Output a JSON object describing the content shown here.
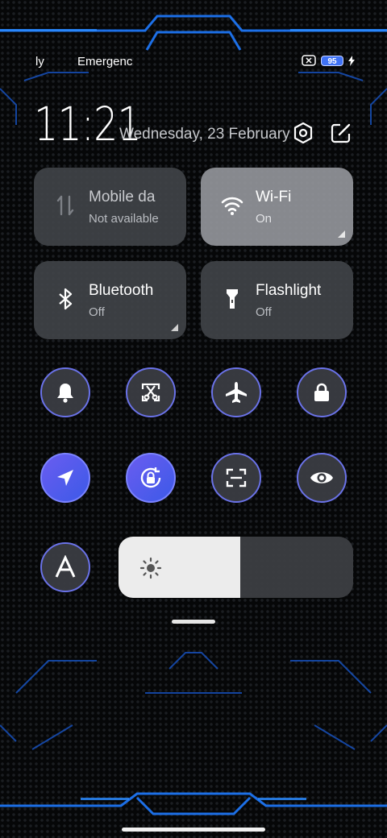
{
  "status_bar": {
    "carrier1": "ly",
    "carrier2": "Emergenc",
    "battery_level": "95"
  },
  "header": {
    "time": "11:21",
    "date": "Wednesday, 23 February"
  },
  "tiles": [
    {
      "title": "Mobile da",
      "status": "Not available",
      "icon": "mobile-data-icon"
    },
    {
      "title": "Wi-Fi",
      "status": "On",
      "icon": "wifi-icon"
    },
    {
      "title": "Bluetooth",
      "status": "Off",
      "icon": "bluetooth-icon"
    },
    {
      "title": "Flashlight",
      "status": "Off",
      "icon": "flashlight-icon"
    }
  ],
  "toggles": [
    {
      "icon": "bell-icon",
      "active": false
    },
    {
      "icon": "screenshot-icon",
      "active": false
    },
    {
      "icon": "airplane-icon",
      "active": false
    },
    {
      "icon": "lock-icon",
      "active": false
    },
    {
      "icon": "location-icon",
      "active": true
    },
    {
      "icon": "rotation-lock-icon",
      "active": true
    },
    {
      "icon": "scanner-icon",
      "active": false
    },
    {
      "icon": "eye-icon",
      "active": false
    },
    {
      "icon": "auto-brightness-icon",
      "active": false
    }
  ],
  "brightness": {
    "level": 0.52
  },
  "colors": {
    "accent": "#6a72e8",
    "active_toggle": "#5a5cf0",
    "wallpaper_glow": "#1e6cff"
  }
}
